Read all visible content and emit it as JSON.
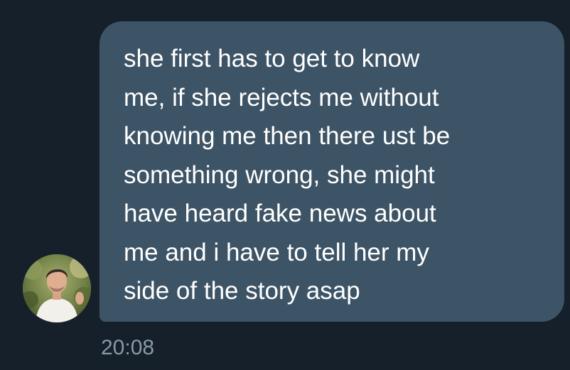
{
  "message": {
    "text": "she first has to get to know\nme, if she rejects me without\nknowing me then there ust be\nsomething wrong, she might\nhave heard fake news about\nme and i have to tell her my\nside of the story asap",
    "timestamp": "20:08"
  },
  "colors": {
    "background": "#15202b",
    "bubble": "#3d5466",
    "text": "#ffffff",
    "timestamp": "#8899a6"
  },
  "icons": {
    "avatar": "user-avatar-photo"
  }
}
